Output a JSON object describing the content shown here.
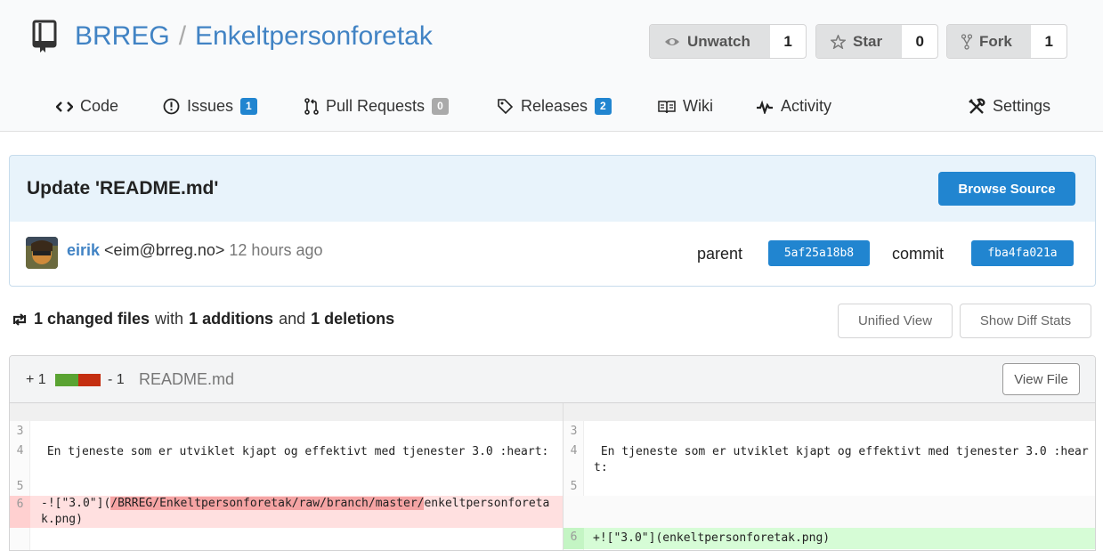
{
  "repo": {
    "owner": "BRREG",
    "separator": "/",
    "name": "Enkeltpersonforetak"
  },
  "actions": {
    "watch": {
      "label": "Unwatch",
      "count": "1"
    },
    "star": {
      "label": "Star",
      "count": "0"
    },
    "fork": {
      "label": "Fork",
      "count": "1"
    }
  },
  "tabs": {
    "code": "Code",
    "issues": {
      "label": "Issues",
      "count": "1"
    },
    "pulls": {
      "label": "Pull Requests",
      "count": "0"
    },
    "releases": {
      "label": "Releases",
      "count": "2"
    },
    "wiki": "Wiki",
    "activity": "Activity",
    "settings": "Settings"
  },
  "commit": {
    "title": "Update 'README.md'",
    "browse_label": "Browse Source",
    "author": "eirik",
    "email": "<eim@brreg.no>",
    "time": "12 hours ago",
    "parent_label": "parent",
    "parent_sha": "5af25a18b8",
    "commit_label": "commit",
    "commit_sha": "fba4fa021a"
  },
  "stats": {
    "changed": "1 changed files",
    "with": "with",
    "additions": "1 additions",
    "and": "and",
    "deletions": "1 deletions",
    "unified_view": "Unified View",
    "show_diff_stats": "Show Diff Stats"
  },
  "file": {
    "additions": "+ 1",
    "deletions": "- 1",
    "name": "README.md",
    "view_file": "View File",
    "left": {
      "rows": [
        {
          "ln": "3",
          "code": ""
        },
        {
          "ln": "4",
          "code": " En tjeneste som er utviklet kjapt og effektivt med tjenester 3.0 :heart:"
        },
        {
          "ln": "5",
          "code": ""
        },
        {
          "ln": "6",
          "code_pre": "-![\"3.0\"](",
          "code_hl": "/BRREG/Enkeltpersonforetak/raw/branch/master/",
          "code_post": "enkeltpersonforetak.png)"
        }
      ]
    },
    "right": {
      "rows": [
        {
          "ln": "3",
          "code": ""
        },
        {
          "ln": "4",
          "code": " En tjeneste som er utviklet kjapt og effektivt med tjenester 3.0 :heart:"
        },
        {
          "ln": "5",
          "code": ""
        },
        {
          "ln": "6",
          "code": "+![\"3.0\"](enkeltpersonforetak.png)"
        }
      ]
    }
  },
  "colors": {
    "accent": "#2185d0",
    "link": "#4183c4",
    "addition": "#5aa332",
    "deletion": "#c42e10"
  }
}
